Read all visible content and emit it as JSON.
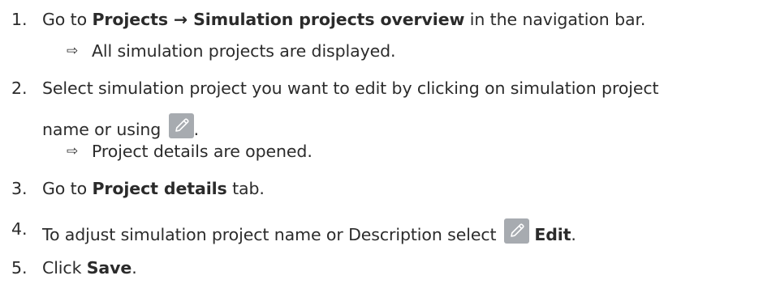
{
  "colors": {
    "icon_background": "#a7abb0",
    "icon_stroke": "#ffffff",
    "text": "#2b2b2b"
  },
  "steps": [
    {
      "number": "1.",
      "prefix": "Go to ",
      "bold1": "Projects",
      "arrow": " → ",
      "bold2": "Simulation projects overview",
      "suffix": " in the navigation bar.",
      "result_arrow": "⇨",
      "result": "All simulation projects are displayed."
    },
    {
      "number": "2.",
      "line1": "Select simulation project you want to edit by clicking on simulation project",
      "line2_prefix": "name or using ",
      "icon": "pencil-icon",
      "line2_suffix": ".",
      "result_arrow": "⇨",
      "result": "Project details are opened."
    },
    {
      "number": "3.",
      "prefix": "Go to ",
      "bold": "Project details",
      "suffix": " tab."
    },
    {
      "number": "4.",
      "prefix": "To adjust simulation project name or Description select ",
      "icon": "pencil-icon",
      "bold": "Edit",
      "suffix": "."
    },
    {
      "number": "5.",
      "prefix": "Click ",
      "bold": "Save",
      "suffix": "."
    }
  ]
}
